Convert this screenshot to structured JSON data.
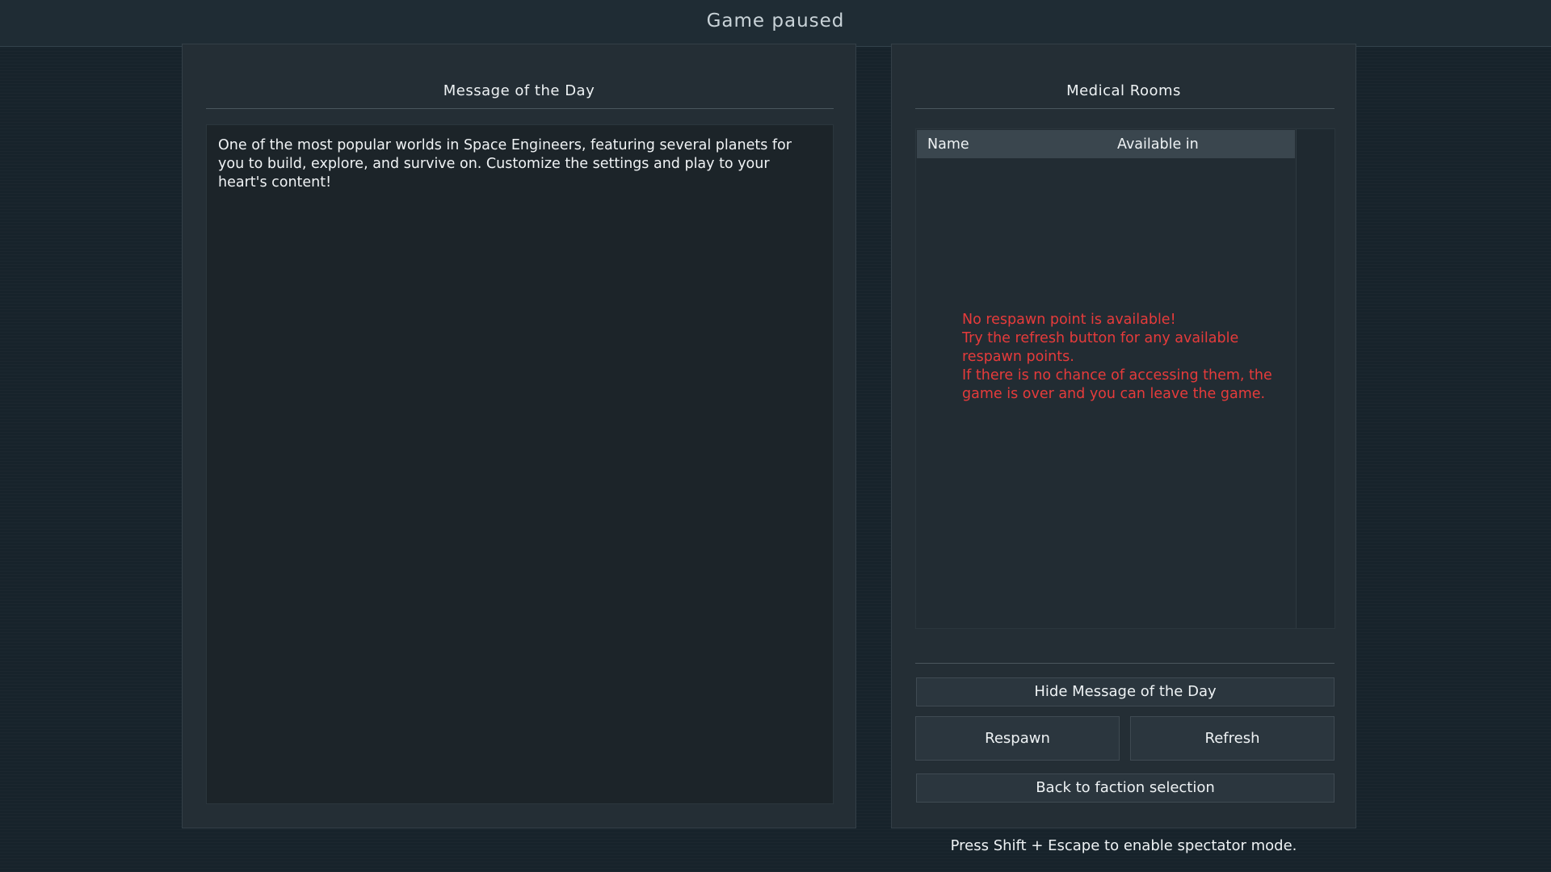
{
  "header": {
    "title": "Game paused"
  },
  "motd": {
    "title": "Message of the Day",
    "text": "One of the most popular worlds in Space Engineers, featuring several planets for you to build, explore, and survive on. Customize the settings and play to your heart's content!"
  },
  "medical": {
    "title": "Medical Rooms",
    "columns": {
      "name": "Name",
      "available_in": "Available in"
    },
    "error_lines": [
      "No respawn point is available!",
      "Try the refresh button for any available respawn points.",
      "If there is no chance of accessing them, the game is over and you can leave the game."
    ]
  },
  "buttons": {
    "hide_motd": "Hide Message of the Day",
    "respawn": "Respawn",
    "refresh": "Refresh",
    "back": "Back to faction selection"
  },
  "footer": {
    "hint": "Press Shift + Escape to enable spectator mode."
  },
  "colors": {
    "error": "#e63b3b",
    "panel": "#242e35",
    "background": "#17232b"
  }
}
